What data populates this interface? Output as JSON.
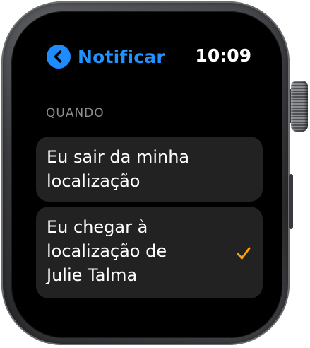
{
  "header": {
    "back_label": "Notificar",
    "time": "10:09"
  },
  "section": {
    "title": "QUANDO"
  },
  "options": [
    {
      "label": "Eu sair da minha\nlocalização",
      "selected": false
    },
    {
      "label": "Eu chegar à\nlocalização de\nJulie Talma",
      "selected": true
    }
  ],
  "icons": {
    "back": "chevron-left-icon",
    "check": "checkmark-icon"
  },
  "colors": {
    "accent_blue": "#1E8BFF",
    "check_orange": "#FF9F0A",
    "card_background": "#222223",
    "screen_background": "#000000",
    "section_header": "#8E8E93"
  }
}
